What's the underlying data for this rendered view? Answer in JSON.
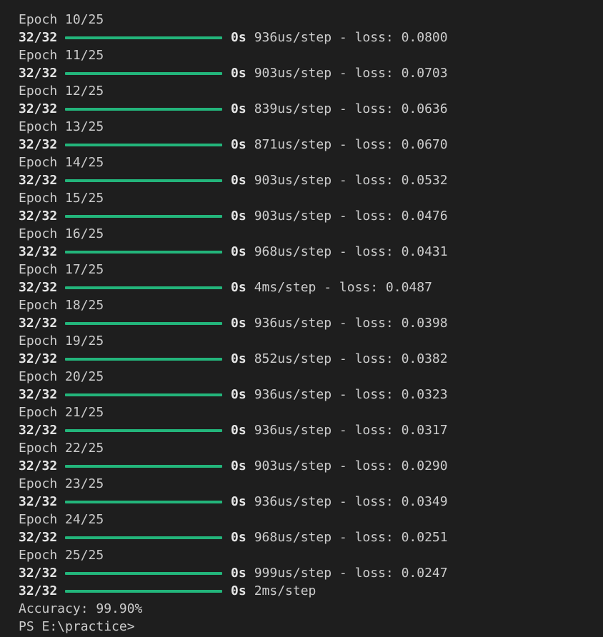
{
  "terminal": {
    "accent_color": "#23b57b",
    "epochs": [
      {
        "epoch": "Epoch 10/25",
        "steps": "32/32",
        "progress": 1.0,
        "duration": "0s",
        "metrics": "936us/step - loss: 0.0800"
      },
      {
        "epoch": "Epoch 11/25",
        "steps": "32/32",
        "progress": 1.0,
        "duration": "0s",
        "metrics": "903us/step - loss: 0.0703"
      },
      {
        "epoch": "Epoch 12/25",
        "steps": "32/32",
        "progress": 1.0,
        "duration": "0s",
        "metrics": "839us/step - loss: 0.0636"
      },
      {
        "epoch": "Epoch 13/25",
        "steps": "32/32",
        "progress": 1.0,
        "duration": "0s",
        "metrics": "871us/step - loss: 0.0670"
      },
      {
        "epoch": "Epoch 14/25",
        "steps": "32/32",
        "progress": 1.0,
        "duration": "0s",
        "metrics": "903us/step - loss: 0.0532"
      },
      {
        "epoch": "Epoch 15/25",
        "steps": "32/32",
        "progress": 1.0,
        "duration": "0s",
        "metrics": "903us/step - loss: 0.0476"
      },
      {
        "epoch": "Epoch 16/25",
        "steps": "32/32",
        "progress": 1.0,
        "duration": "0s",
        "metrics": "968us/step - loss: 0.0431"
      },
      {
        "epoch": "Epoch 17/25",
        "steps": "32/32",
        "progress": 1.0,
        "duration": "0s",
        "metrics": "4ms/step - loss: 0.0487"
      },
      {
        "epoch": "Epoch 18/25",
        "steps": "32/32",
        "progress": 1.0,
        "duration": "0s",
        "metrics": "936us/step - loss: 0.0398"
      },
      {
        "epoch": "Epoch 19/25",
        "steps": "32/32",
        "progress": 1.0,
        "duration": "0s",
        "metrics": "852us/step - loss: 0.0382"
      },
      {
        "epoch": "Epoch 20/25",
        "steps": "32/32",
        "progress": 1.0,
        "duration": "0s",
        "metrics": "936us/step - loss: 0.0323"
      },
      {
        "epoch": "Epoch 21/25",
        "steps": "32/32",
        "progress": 1.0,
        "duration": "0s",
        "metrics": "936us/step - loss: 0.0317"
      },
      {
        "epoch": "Epoch 22/25",
        "steps": "32/32",
        "progress": 1.0,
        "duration": "0s",
        "metrics": "903us/step - loss: 0.0290"
      },
      {
        "epoch": "Epoch 23/25",
        "steps": "32/32",
        "progress": 1.0,
        "duration": "0s",
        "metrics": "936us/step - loss: 0.0349"
      },
      {
        "epoch": "Epoch 24/25",
        "steps": "32/32",
        "progress": 1.0,
        "duration": "0s",
        "metrics": "968us/step - loss: 0.0251"
      },
      {
        "epoch": "Epoch 25/25",
        "steps": "32/32",
        "progress": 1.0,
        "duration": "0s",
        "metrics": "999us/step - loss: 0.0247"
      }
    ],
    "eval": {
      "steps": "32/32",
      "progress": 1.0,
      "duration": "0s",
      "metrics": "2ms/step"
    },
    "accuracy_line": "Accuracy: 99.90%",
    "prompt": "PS E:\\practice>"
  }
}
